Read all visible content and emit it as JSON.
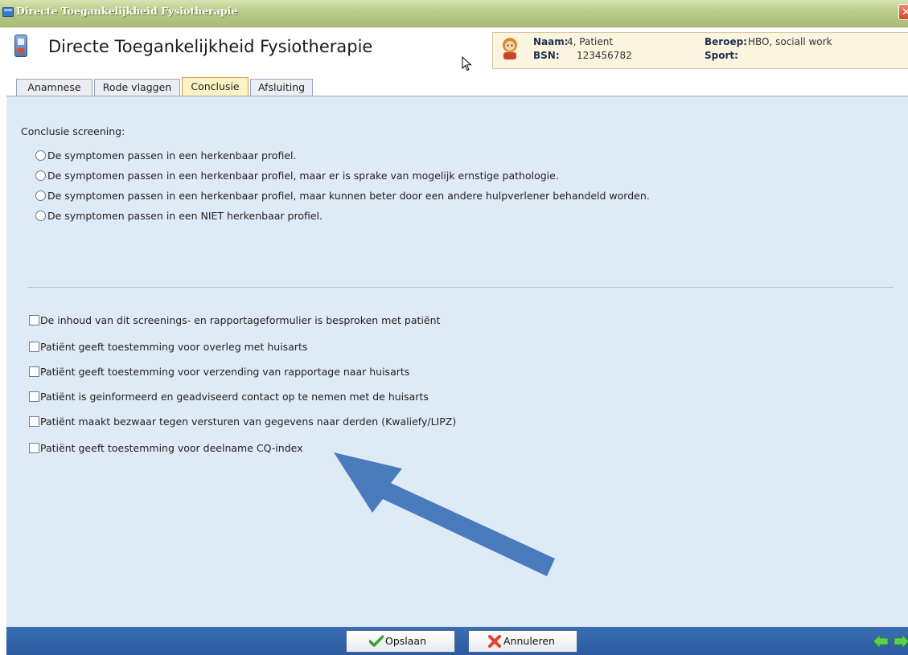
{
  "window": {
    "title": "Directe Toegankelijkheid Fysiotherapie"
  },
  "header": {
    "title": "Directe Toegankelijkheid Fysiotherapie"
  },
  "patient": {
    "naam_label": "Naam:",
    "naam_value": "4, Patient",
    "bsn_label": "BSN:",
    "bsn_value": "123456782",
    "beroep_label": "Beroep:",
    "beroep_value": "HBO, sociall work",
    "sport_label": "Sport:",
    "sport_value": ""
  },
  "tabs": [
    {
      "label": "Anamnese",
      "active": false
    },
    {
      "label": "Rode vlaggen",
      "active": false
    },
    {
      "label": "Conclusie",
      "active": true
    },
    {
      "label": "Afsluiting",
      "active": false
    }
  ],
  "conclusie": {
    "label": "Conclusie screening:",
    "options": [
      "De symptomen passen in een herkenbaar profiel.",
      "De symptomen passen in een herkenbaar profiel, maar er is sprake van mogelijk ernstige pathologie.",
      "De symptomen passen in een herkenbaar profiel, maar kunnen beter door een andere hulpverlener behandeld worden.",
      "De symptomen passen in een NIET herkenbaar profiel."
    ]
  },
  "checkboxes": [
    "De inhoud van dit screenings- en rapportageformulier is besproken met patiënt",
    "Patiënt geeft toestemming voor overleg met huisarts",
    "Patiënt geeft toestemming voor verzending van rapportage naar huisarts",
    "Patiënt is geinformeerd en geadviseerd contact op te nemen met de huisarts",
    "Patiënt maakt bezwaar tegen versturen van gegevens naar derden (Kwaliefy/LIPZ)",
    "Patiënt geeft toestemming voor deelname CQ-index"
  ],
  "footer": {
    "save_label": "Opslaan",
    "cancel_label": "Annuleren"
  },
  "colors": {
    "titlebar": "#b9c98a",
    "content_bg": "#dfeaf7",
    "bottombar": "#2b5aa0",
    "arrow": "#4a7bbd",
    "active_tab": "#fdf2c4"
  }
}
